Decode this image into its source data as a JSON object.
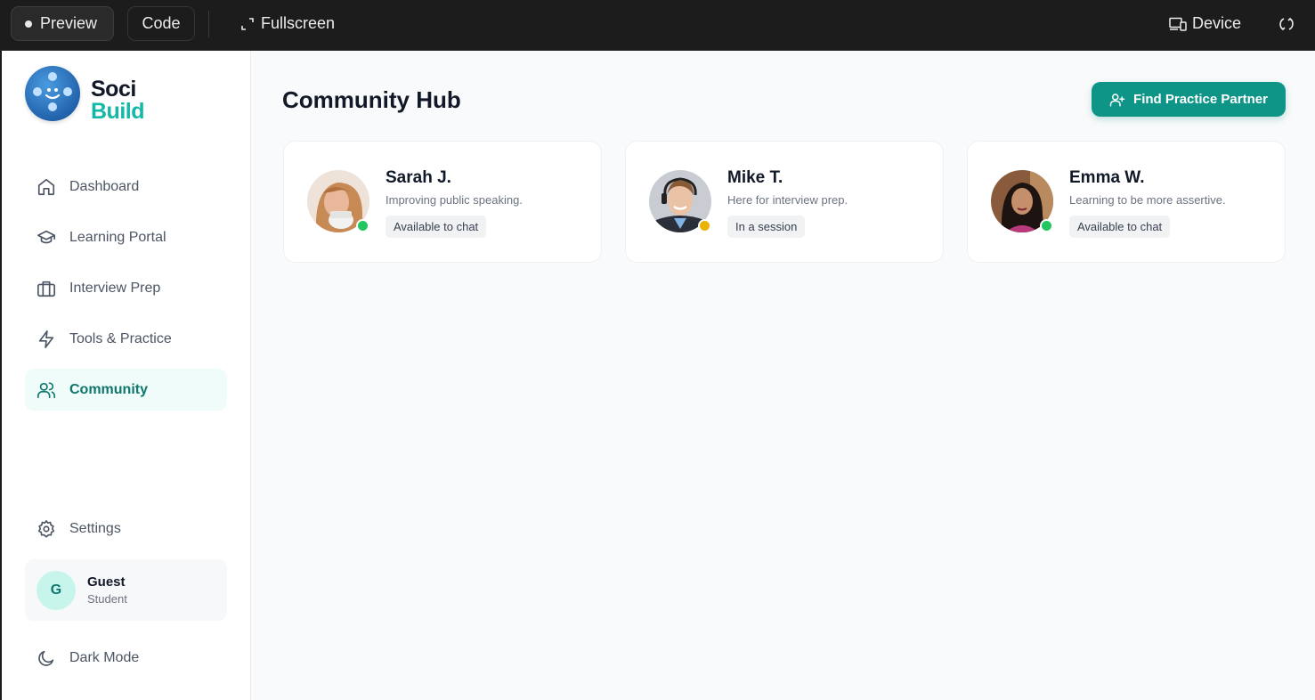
{
  "topbar": {
    "preview_label": "Preview",
    "code_label": "Code",
    "fullscreen_label": "Fullscreen",
    "device_label": "Device"
  },
  "brand": {
    "line1": "Soci",
    "line2": "Build"
  },
  "sidebar": {
    "items": [
      {
        "label": "Dashboard",
        "icon": "home-icon"
      },
      {
        "label": "Learning Portal",
        "icon": "graduation-cap-icon"
      },
      {
        "label": "Interview Prep",
        "icon": "briefcase-icon"
      },
      {
        "label": "Tools & Practice",
        "icon": "zap-icon"
      },
      {
        "label": "Community",
        "icon": "users-icon",
        "active": true
      }
    ],
    "settings_label": "Settings",
    "dark_mode_label": "Dark Mode"
  },
  "user": {
    "initial": "G",
    "name": "Guest",
    "role": "Student"
  },
  "main": {
    "title": "Community Hub",
    "find_partner_label": "Find Practice Partner"
  },
  "members": [
    {
      "name": "Sarah J.",
      "description": "Improving public speaking.",
      "status": "Available to chat",
      "status_color": "#22c55e"
    },
    {
      "name": "Mike T.",
      "description": "Here for interview prep.",
      "status": "In a session",
      "status_color": "#eab308"
    },
    {
      "name": "Emma W.",
      "description": "Learning to be more assertive.",
      "status": "Available to chat",
      "status_color": "#22c55e"
    }
  ],
  "colors": {
    "accent": "#0f9488",
    "brand_teal": "#14b8a6",
    "active_nav_bg": "#effcf9"
  }
}
